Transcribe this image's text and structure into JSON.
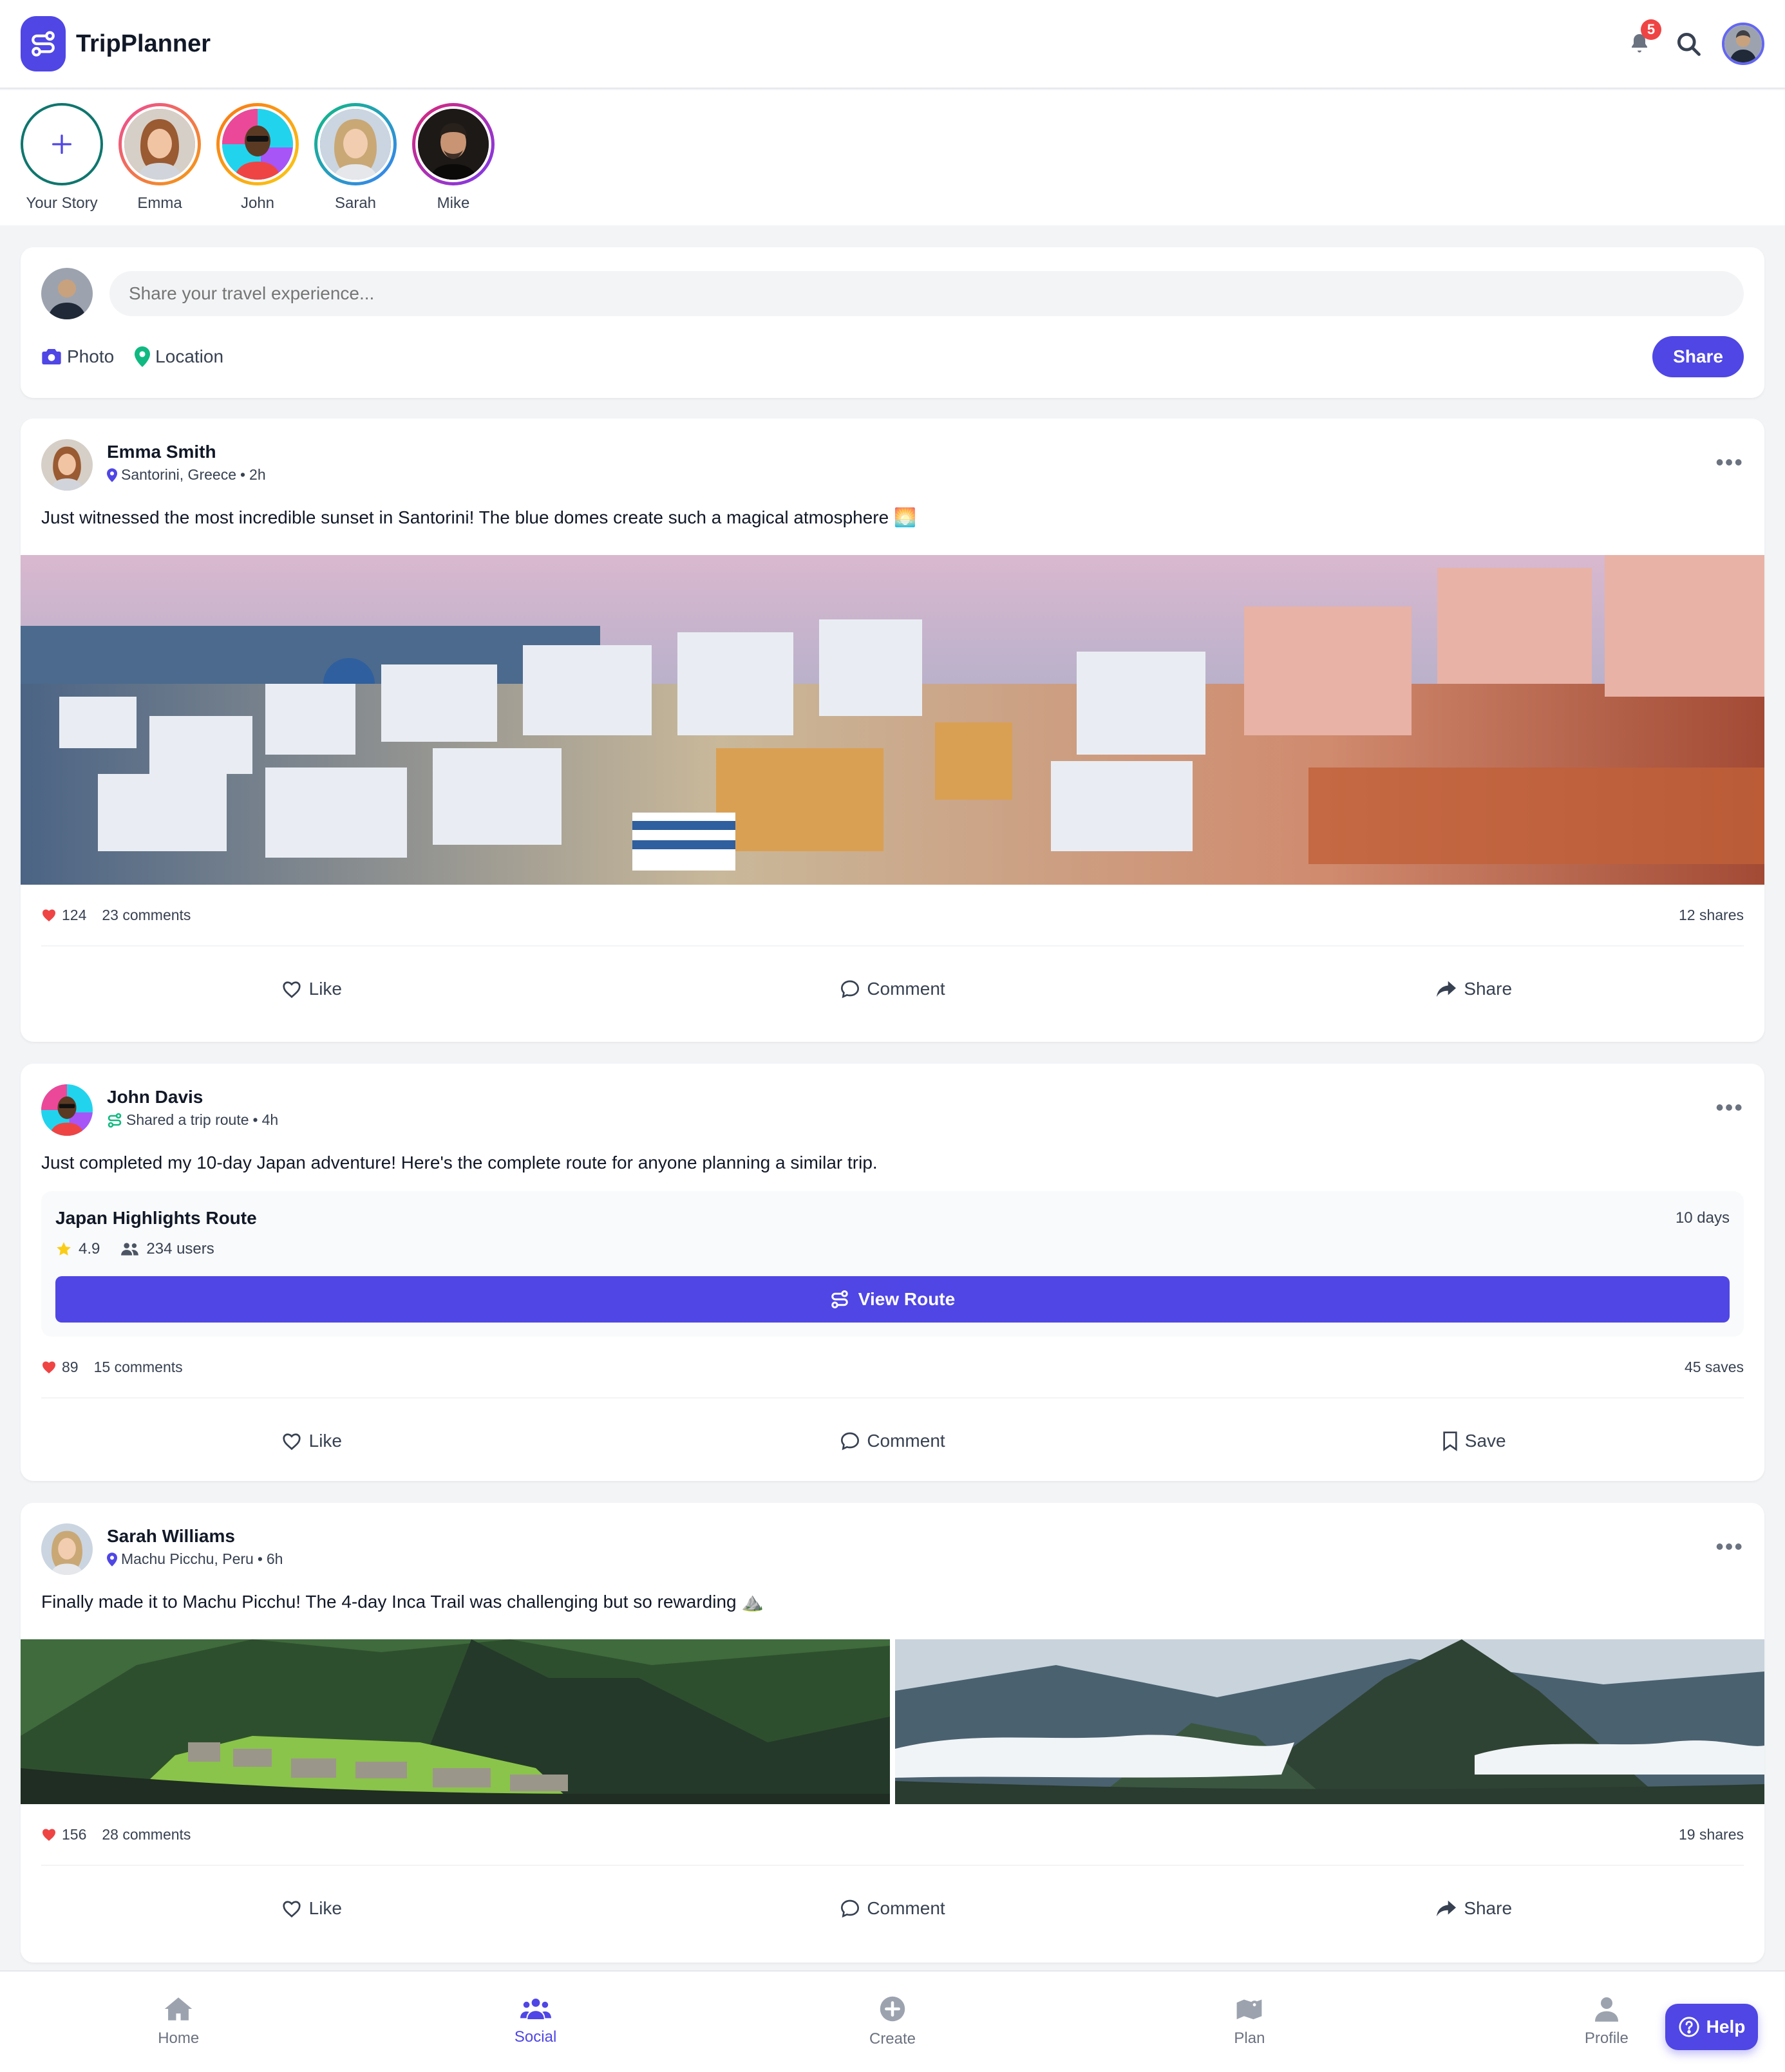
{
  "app": {
    "name": "TripPlanner",
    "accent": "#4f46e5",
    "notification_count": "5"
  },
  "stories": [
    {
      "label": "Your Story"
    },
    {
      "label": "Emma",
      "ring": "#ec4899"
    },
    {
      "label": "John",
      "ring": "#f97316"
    },
    {
      "label": "Sarah",
      "ring": "#10b981"
    },
    {
      "label": "Mike",
      "ring": "#db2777"
    }
  ],
  "composer": {
    "placeholder": "Share your travel experience...",
    "photo_label": "Photo",
    "location_label": "Location",
    "share_label": "Share"
  },
  "posts": [
    {
      "author": "Emma Smith",
      "sub_location": "Santorini, Greece",
      "sub_time": "2h",
      "text": "Just witnessed the most incredible sunset in Santorini! The blue domes create such a magical atmosphere 🌅",
      "likes": "124",
      "comments": "23 comments",
      "right_stat": "12 shares",
      "actions": [
        "Like",
        "Comment",
        "Share"
      ]
    },
    {
      "author": "John Davis",
      "sub_location": "Shared a trip route",
      "sub_time": "4h",
      "text": "Just completed my 10-day Japan adventure! Here's the complete route for anyone planning a similar trip.",
      "route": {
        "title": "Japan Highlights Route",
        "days": "10 days",
        "rating": "4.9",
        "users": "234 users",
        "button": "View Route"
      },
      "likes": "89",
      "comments": "15 comments",
      "right_stat": "45 saves",
      "actions": [
        "Like",
        "Comment",
        "Save"
      ]
    },
    {
      "author": "Sarah Williams",
      "sub_location": "Machu Picchu, Peru",
      "sub_time": "6h",
      "text": "Finally made it to Machu Picchu! The 4-day Inca Trail was challenging but so rewarding ⛰️",
      "likes": "156",
      "comments": "28 comments",
      "right_stat": "19 shares",
      "actions": [
        "Like",
        "Comment",
        "Share"
      ]
    }
  ],
  "nav": [
    {
      "label": "Home",
      "icon": "home-icon"
    },
    {
      "label": "Social",
      "icon": "users-icon",
      "active": true
    },
    {
      "label": "Create",
      "icon": "plus-circle-icon"
    },
    {
      "label": "Plan",
      "icon": "map-icon"
    },
    {
      "label": "Profile",
      "icon": "user-icon"
    }
  ],
  "help_label": "Help"
}
